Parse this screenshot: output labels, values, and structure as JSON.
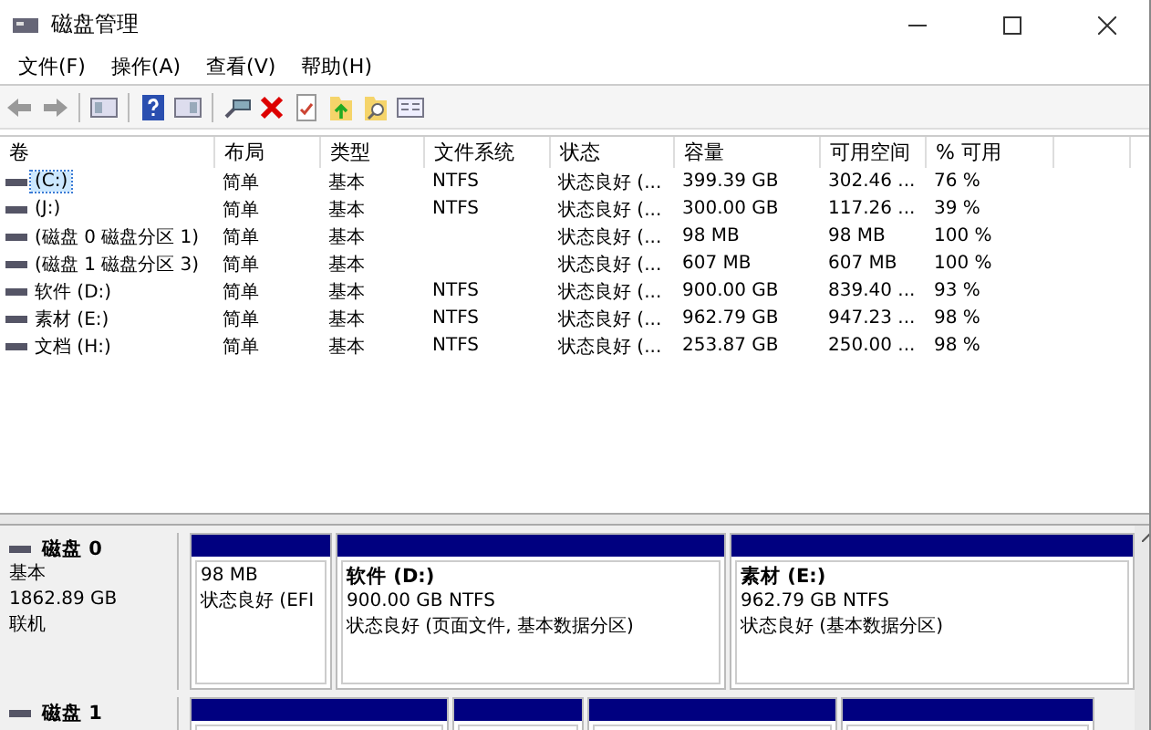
{
  "window": {
    "title": "磁盘管理"
  },
  "menu": [
    {
      "label": "文件(F)"
    },
    {
      "label": "操作(A)"
    },
    {
      "label": "查看(V)"
    },
    {
      "label": "帮助(H)"
    }
  ],
  "toolbar": [
    {
      "kind": "back"
    },
    {
      "kind": "forward"
    },
    {
      "kind": "sep"
    },
    {
      "kind": "panel"
    },
    {
      "kind": "sep"
    },
    {
      "kind": "help"
    },
    {
      "kind": "panel2"
    },
    {
      "kind": "sep"
    },
    {
      "kind": "connect"
    },
    {
      "kind": "delete"
    },
    {
      "kind": "check"
    },
    {
      "kind": "folder-up"
    },
    {
      "kind": "folder-search"
    },
    {
      "kind": "props"
    }
  ],
  "table": {
    "columns": [
      "卷",
      "布局",
      "类型",
      "文件系统",
      "状态",
      "容量",
      "可用空间",
      "% 可用"
    ],
    "rows": [
      {
        "selected": true,
        "cells": [
          "(C:)",
          "简单",
          "基本",
          "NTFS",
          "状态良好 (...",
          "399.39 GB",
          "302.46 ...",
          "76 %"
        ]
      },
      {
        "selected": false,
        "cells": [
          "(J:)",
          "简单",
          "基本",
          "NTFS",
          "状态良好 (...",
          "300.00 GB",
          "117.26 ...",
          "39 %"
        ]
      },
      {
        "selected": false,
        "cells": [
          "(磁盘 0 磁盘分区 1)",
          "简单",
          "基本",
          "",
          "状态良好 (...",
          "98 MB",
          "98 MB",
          "100 %"
        ]
      },
      {
        "selected": false,
        "cells": [
          "(磁盘 1 磁盘分区 3)",
          "简单",
          "基本",
          "",
          "状态良好 (...",
          "607 MB",
          "607 MB",
          "100 %"
        ]
      },
      {
        "selected": false,
        "cells": [
          "软件 (D:)",
          "简单",
          "基本",
          "NTFS",
          "状态良好 (...",
          "900.00 GB",
          "839.40 ...",
          "93 %"
        ]
      },
      {
        "selected": false,
        "cells": [
          "素材 (E:)",
          "简单",
          "基本",
          "NTFS",
          "状态良好 (...",
          "962.79 GB",
          "947.23 ...",
          "98 %"
        ]
      },
      {
        "selected": false,
        "cells": [
          "文档 (H:)",
          "简单",
          "基本",
          "NTFS",
          "状态良好 (...",
          "253.87 GB",
          "250.00 ...",
          "98 %"
        ]
      }
    ]
  },
  "disks": [
    {
      "name": "磁盘 0",
      "lines": [
        "基本",
        "1862.89 GB",
        "联机"
      ],
      "partitions": [
        {
          "kind": "volume",
          "lines": [
            "98 MB",
            "状态良好 (EFI"
          ]
        },
        {
          "kind": "volume",
          "label": "软件  (D:)",
          "lines": [
            "900.00 GB NTFS",
            "状态良好 (页面文件, 基本数据分区)"
          ]
        },
        {
          "kind": "volume",
          "label": "素材  (E:)",
          "lines": [
            "962.79 GB NTFS",
            "状态良好 (基本数据分区)"
          ]
        }
      ]
    },
    {
      "name": "磁盘 1",
      "partitions": [
        {
          "kind": "volume"
        },
        {
          "kind": "volume"
        },
        {
          "kind": "volume"
        },
        {
          "kind": "volume"
        }
      ]
    }
  ]
}
